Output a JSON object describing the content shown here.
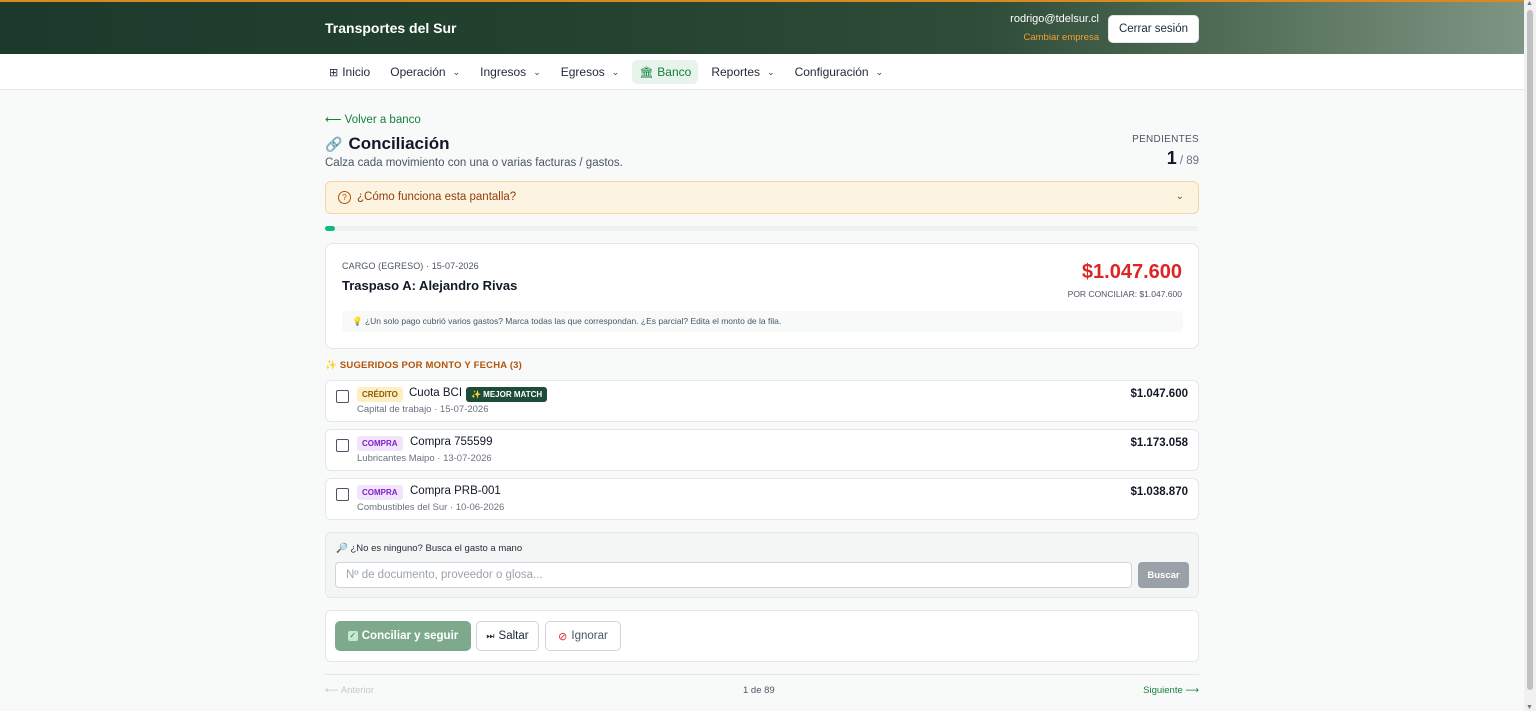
{
  "header": {
    "brand": "Transportes del Sur",
    "user_email": "rodrigo@tdelsur.cl",
    "switch_company": "Cambiar empresa",
    "logout": "Cerrar sesión"
  },
  "nav": {
    "items": [
      {
        "label": "Inicio",
        "icon": "grid-icon",
        "dropdown": false,
        "active": false
      },
      {
        "label": "Operación",
        "dropdown": true,
        "active": false
      },
      {
        "label": "Ingresos",
        "dropdown": true,
        "active": false
      },
      {
        "label": "Egresos",
        "dropdown": true,
        "active": false
      },
      {
        "label": "Banco",
        "icon": "bank-icon",
        "dropdown": false,
        "active": true
      },
      {
        "label": "Reportes",
        "dropdown": true,
        "active": false
      },
      {
        "label": "Configuración",
        "dropdown": true,
        "active": false
      }
    ]
  },
  "page": {
    "back": "⟵ Volver a banco",
    "title": "Conciliación",
    "subtitle": "Calza cada movimiento con una o varias facturas / gastos.",
    "pending_label": "PENDIENTES",
    "pending_current": "1",
    "pending_total": "/ 89",
    "progress": 0.012
  },
  "help": {
    "label": "¿Cómo funciona esta pantalla?"
  },
  "movement": {
    "meta": "CARGO (EGRESO) · 15-07-2026",
    "name": "Traspaso A: Alejandro Rivas",
    "amount": "$1.047.600",
    "to_reconcile": "POR CONCILIAR: $1.047.600",
    "tip": "¿Un solo pago cubrió varios gastos? Marca todas las que correspondan. ¿Es parcial? Edita el monto de la fila."
  },
  "suggestions": {
    "heading": "SUGERIDOS POR MONTO Y FECHA (3)",
    "rows": [
      {
        "badge": "CRÉDITO",
        "badge_type": "credito",
        "name": "Cuota BCI",
        "match": "✨ MEJOR MATCH",
        "sub": "Capital de trabajo · 15-07-2026",
        "amount": "$1.047.600"
      },
      {
        "badge": "COMPRA",
        "badge_type": "compra",
        "name": "Compra 755599",
        "match": "",
        "sub": "Lubricantes Maipo · 13-07-2026",
        "amount": "$1.173.058"
      },
      {
        "badge": "COMPRA",
        "badge_type": "compra",
        "name": "Compra PRB-001",
        "match": "",
        "sub": "Combustibles del Sur · 10-06-2026",
        "amount": "$1.038.870"
      }
    ]
  },
  "manual_search": {
    "label": "¿No es ninguno? Busca el gasto a mano",
    "placeholder": "Nº de documento, proveedor o glosa...",
    "value": "",
    "button": "Buscar"
  },
  "actions": {
    "reconcile": "Conciliar y seguir",
    "skip": "Saltar",
    "ignore": "Ignorar"
  },
  "pager": {
    "prev": "⟵ Anterior",
    "position": "1 de 89",
    "next": "Siguiente ⟶"
  }
}
